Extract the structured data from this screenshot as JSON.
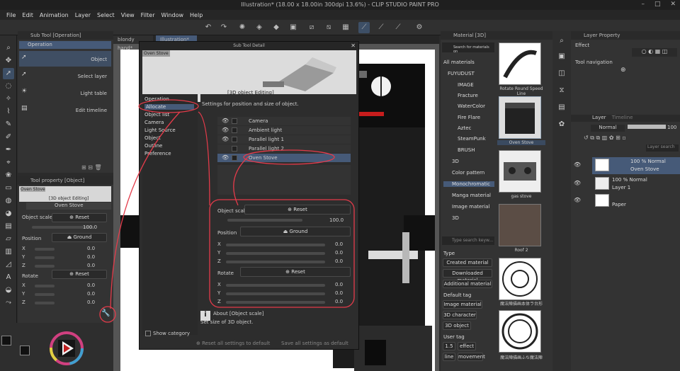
{
  "window": {
    "title": "Illustration* (18.00 x 18.00in 300dpi 13.6%) - CLIP STUDIO PAINT PRO"
  },
  "menu": [
    "File",
    "Edit",
    "Animation",
    "Layer",
    "Select",
    "View",
    "Filter",
    "Window",
    "Help"
  ],
  "doc_tabs": [
    "blondy hand*",
    "Illustration*"
  ],
  "sub_tool": {
    "header": "Sub Tool [Operation]",
    "group": "Operation",
    "items": [
      "Object",
      "Select layer",
      "Light table",
      "Edit timeline"
    ]
  },
  "tool_property": {
    "header": "Tool property [Object]",
    "object_name": "Oven Stove",
    "editing": "[3D object Editing]",
    "object_scale_label": "Object scale",
    "reset_label": "Reset",
    "scale_value": "100.0",
    "position_label": "Position",
    "ground_label": "Ground",
    "rotate_label": "Rotate",
    "axes": [
      "X",
      "Y",
      "Z"
    ],
    "pos_values": [
      "0.0",
      "0.0",
      "0.0"
    ],
    "rot_values": [
      "0.0",
      "0.0",
      "0.0"
    ]
  },
  "dialog": {
    "title": "Sub Tool Detail",
    "preview_tag": "Oven Stove",
    "preview_caption": "[3D object Editing]",
    "categories": [
      "Operation",
      "Allocate",
      "Object list",
      "Camera",
      "Light Source",
      "Object",
      "Outline",
      "Preference"
    ],
    "settings_title": "Settings for position and size of object.",
    "objects": [
      "Camera",
      "Ambient light",
      "Parallel light 1",
      "Parallel light 2",
      "Oven Stove"
    ],
    "object_scale_label": "Object scale",
    "reset_label": "Reset",
    "scale_value": "100.0",
    "position_label": "Position",
    "ground_label": "Ground",
    "rotate_label": "Rotate",
    "axes": [
      "X",
      "Y",
      "Z"
    ],
    "pos_values": [
      "0.0",
      "0.0",
      "0.0"
    ],
    "rot_values": [
      "0.0",
      "0.0",
      "0.0"
    ],
    "about_title": "About [Object scale]",
    "about_text": "Set size of 3D object.",
    "show_category": "Show category",
    "reset_all": "Reset all settings to default",
    "save_all": "Save all settings as default"
  },
  "material": {
    "header": "Material [3D]",
    "search_placeholder": "Search for materials on",
    "tree": [
      "All materials",
      "FUYUDUST",
      "IMAGE",
      "Fracture",
      "WaterColor",
      "Fire Flare",
      "Aztec",
      "SteamPunk",
      "BRUSH",
      "3D",
      "Color pattern",
      "Monochromatic",
      "Manga material",
      "Image material",
      "3D"
    ],
    "search2_placeholder": "Type search keyw...",
    "type_label": "Type",
    "type_buttons": [
      "Created material",
      "Downloaded material",
      "Additional material"
    ],
    "default_tag_label": "Default tag",
    "default_tags": [
      "Image material",
      "3D character",
      "3D object"
    ],
    "user_tag_label": "User tag",
    "user_tags": [
      "1.5",
      "effect",
      "line",
      "movement"
    ],
    "thumbs": [
      "Rotate Round Speed Line",
      "Oven Stove",
      "gas stove",
      "Roof 2",
      "魔法陣描画本体ラ台形",
      "魔法陣描画ふち魔法陣"
    ]
  },
  "layer_property": {
    "header": "Layer Property",
    "effect_label": "Effect",
    "tool_nav_label": "Tool navigation"
  },
  "layer_panel": {
    "tabs": [
      "Layer",
      "Timeline"
    ],
    "blend_mode": "Normal",
    "opacity": "100",
    "search_placeholder": "Layer search",
    "layers": [
      {
        "name": "Oven Stove",
        "mode": "100 % Normal"
      },
      {
        "name": "Layer 1",
        "mode": "100 % Normal"
      },
      {
        "name": "Paper",
        "mode": ""
      }
    ]
  },
  "colors": {
    "accent": "#465a78",
    "annotation": "#e43b4a"
  }
}
